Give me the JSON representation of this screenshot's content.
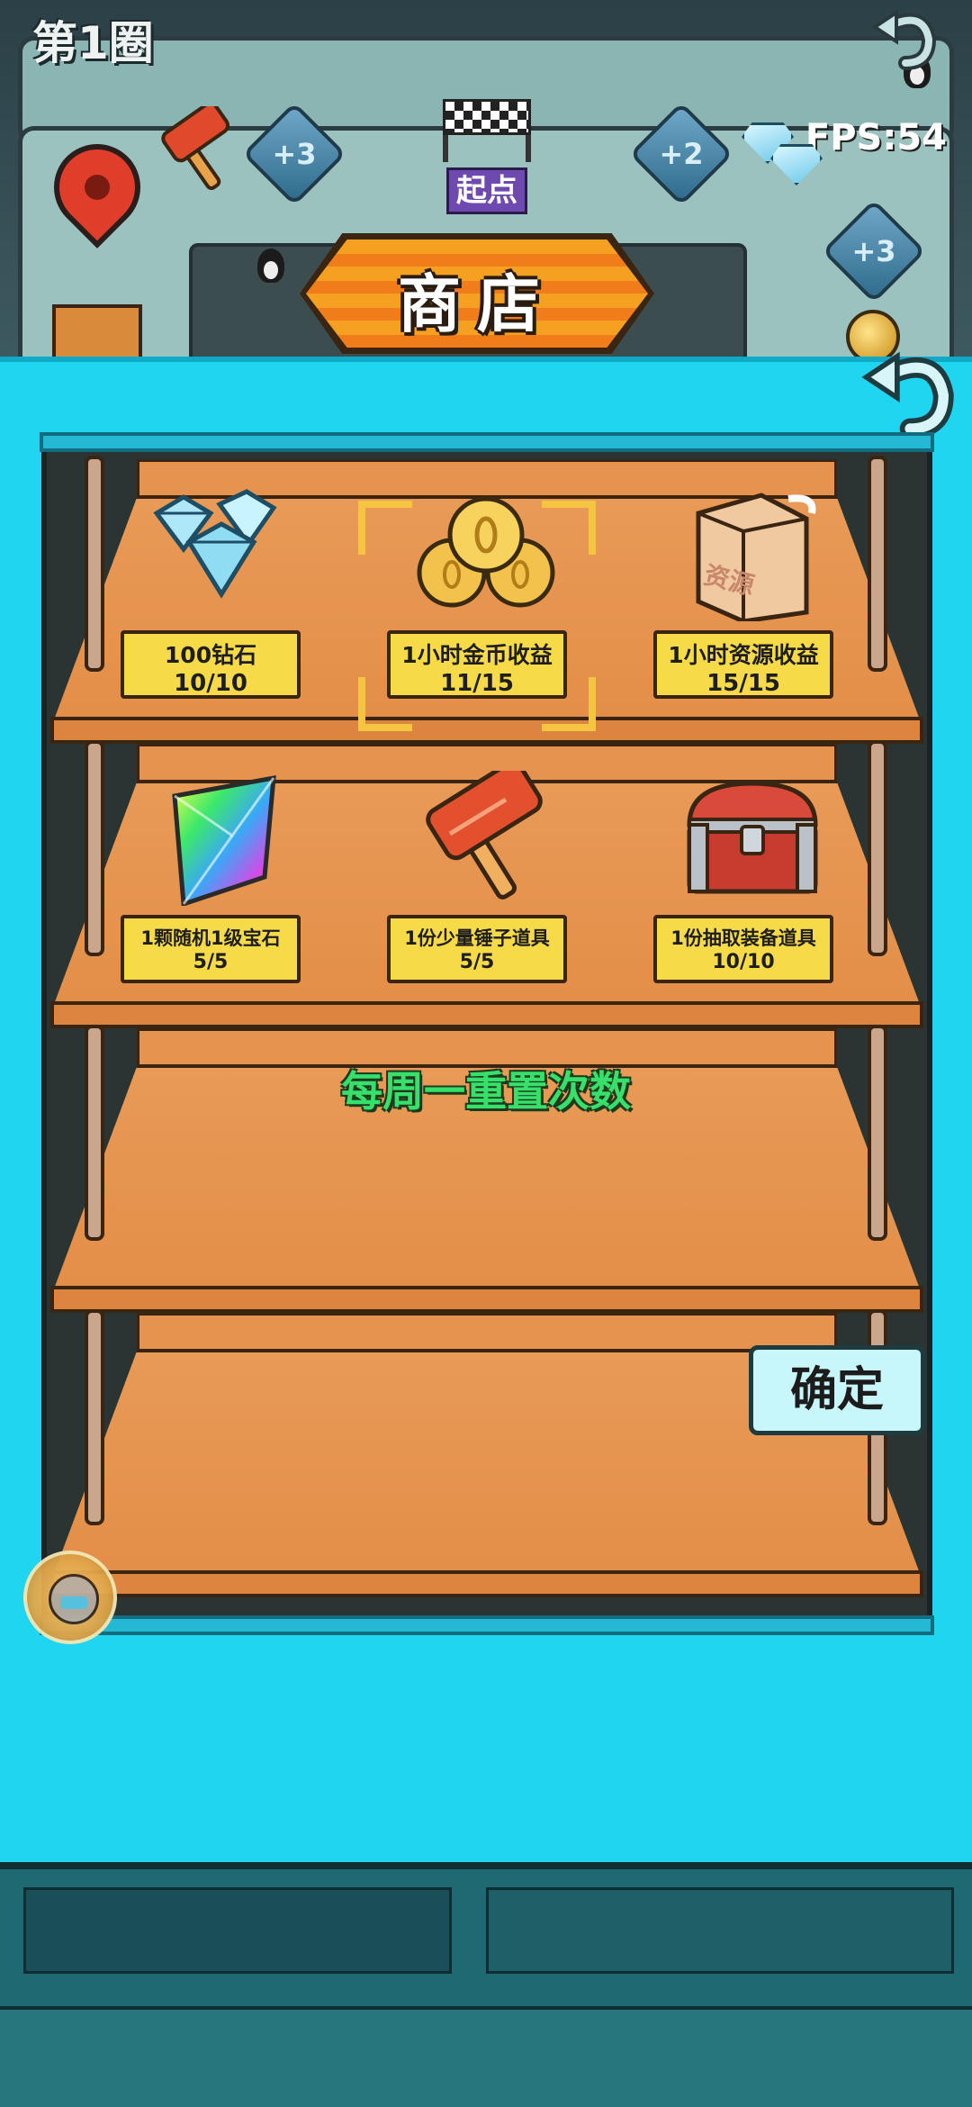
{
  "board": {
    "round_label": "第1圈",
    "fps_label": "FPS:54",
    "start_label": "起点",
    "tiles": [
      "+3",
      "+2",
      "+3"
    ]
  },
  "shop": {
    "title": "商店",
    "items": [
      {
        "name": "100钻石",
        "stock": "10/10",
        "icon": "diamonds-icon"
      },
      {
        "name": "1小时金币收益",
        "stock": "11/15",
        "icon": "gold-coins-icon",
        "selected": true
      },
      {
        "name": "1小时资源收益",
        "stock": "15/15",
        "icon": "resource-bag-icon"
      },
      {
        "name": "1颗随机1级宝石",
        "stock": "5/5",
        "icon": "rainbow-gem-icon"
      },
      {
        "name": "1份少量锤子道具",
        "stock": "5/5",
        "icon": "hammer-icon"
      },
      {
        "name": "1份抽取装备道具",
        "stock": "10/10",
        "icon": "treasure-chest-icon"
      }
    ],
    "reset_note": "每周一重置次数",
    "confirm_label": "确定",
    "resource_bag_text": "资源"
  },
  "colors": {
    "panel_bg": "#1fd5f0",
    "label_bg": "#f6da48",
    "banner_orange": "#f5a020",
    "reset_text": "#36e06a"
  }
}
